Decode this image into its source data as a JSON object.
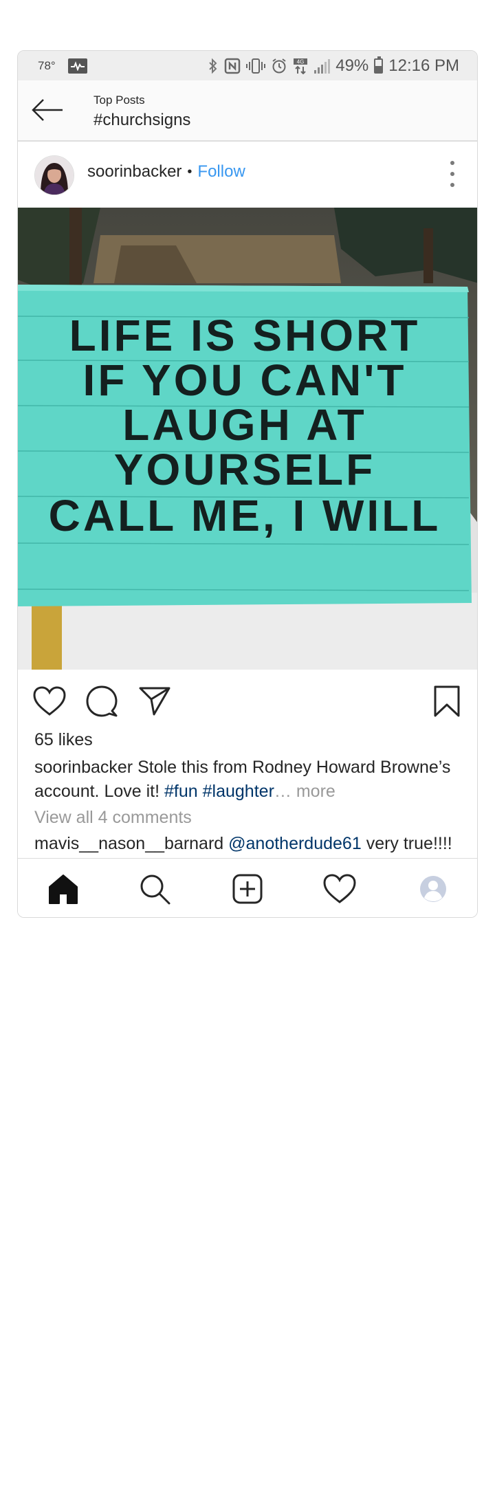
{
  "status_bar": {
    "temperature": "78°",
    "battery_percent": "49%",
    "time": "12:16 PM",
    "battery_level": 0.49,
    "icons": [
      "pulse-icon",
      "bluetooth-icon",
      "nfc-icon",
      "vibrate-icon",
      "alarm-icon",
      "4g-lte-icon",
      "signal-icon",
      "battery-icon"
    ]
  },
  "header": {
    "subtitle": "Top Posts",
    "title": "#churchsigns",
    "back_icon": "arrow-left-icon"
  },
  "post": {
    "username": "soorinbacker",
    "separator": "•",
    "follow_label": "Follow",
    "image": {
      "sign_lines": [
        "LIFE IS SHORT",
        "IF YOU CAN'T",
        "LAUGH AT",
        "YOURSELF",
        "CALL ME, I WILL"
      ],
      "sign_color": "#5fd6c7"
    },
    "likes": "65 likes",
    "caption_user": "soorinbacker",
    "caption_text": "Stole this from Rodney Howard Browne’s account. Love it!",
    "hashtag_1": "#fun",
    "hashtag_2": "#laughter",
    "more_label": "… more",
    "view_comments": "View all 4 comments",
    "comment_user": "mavis__nason__barnard",
    "comment_mention": "@anotherdude61",
    "comment_text": "very true!!!!"
  },
  "colors": {
    "follow": "#3897f0",
    "hashtag": "#003569",
    "muted": "#999999",
    "text": "#262626"
  },
  "tab_bar": {
    "items": [
      "home-icon",
      "search-icon",
      "new-post-icon",
      "activity-heart-icon",
      "profile-icon"
    ]
  }
}
